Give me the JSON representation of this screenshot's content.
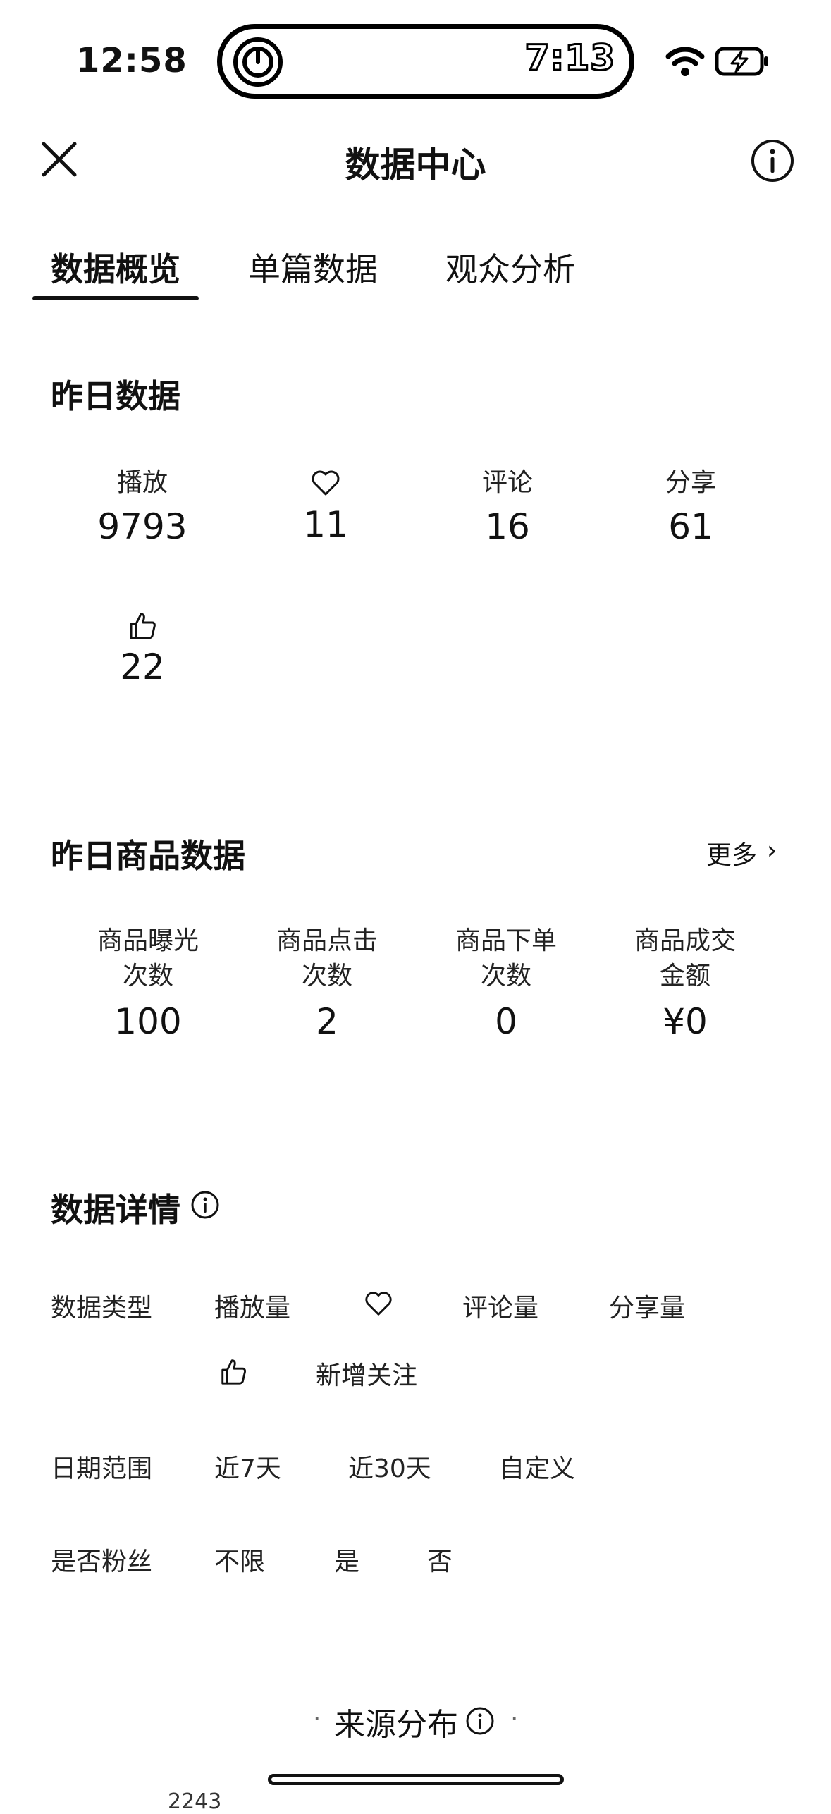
{
  "status_bar": {
    "time": "12:58",
    "island_time": "7:13"
  },
  "header": {
    "title": "数据中心"
  },
  "tabs": [
    {
      "label": "数据概览",
      "active": true
    },
    {
      "label": "单篇数据",
      "active": false
    },
    {
      "label": "观众分析",
      "active": false
    }
  ],
  "yesterday": {
    "title": "昨日数据",
    "stats": [
      {
        "label": "播放",
        "value": "9793"
      },
      {
        "icon": "heart-icon",
        "value": "11"
      },
      {
        "label": "评论",
        "value": "16"
      },
      {
        "label": "分享",
        "value": "61"
      },
      {
        "icon": "thumbs-up-icon",
        "value": "22"
      }
    ]
  },
  "product": {
    "title": "昨日商品数据",
    "more": "更多",
    "stats": [
      {
        "label1": "商品曝光",
        "label2": "次数",
        "value": "100"
      },
      {
        "label1": "商品点击",
        "label2": "次数",
        "value": "2"
      },
      {
        "label1": "商品下单",
        "label2": "次数",
        "value": "0"
      },
      {
        "label1": "商品成交",
        "label2": "金额",
        "value": "¥0"
      }
    ]
  },
  "details": {
    "title": "数据详情",
    "type_label": "数据类型",
    "type_options": [
      "播放量",
      "评论量",
      "分享量",
      "新增关注"
    ],
    "date_label": "日期范围",
    "date_options": [
      "近7天",
      "近30天",
      "自定义"
    ],
    "fan_label": "是否粉丝",
    "fan_options": [
      "不限",
      "是",
      "否"
    ]
  },
  "source": {
    "title": "来源分布",
    "partial_value": "2243"
  }
}
